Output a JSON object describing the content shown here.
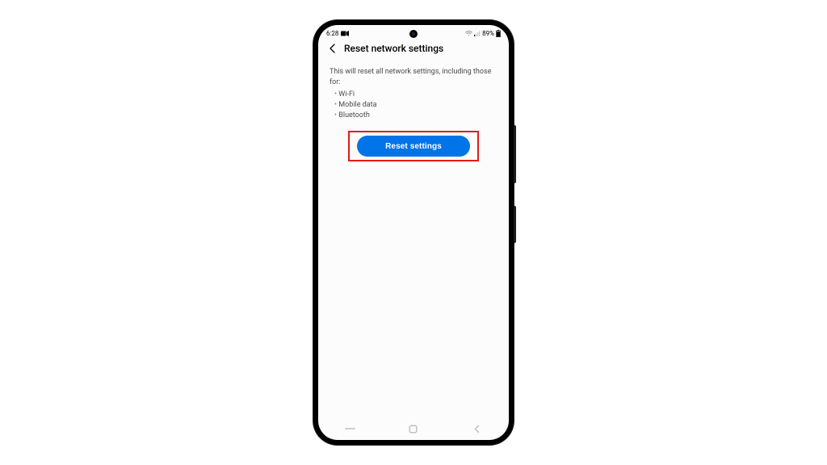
{
  "status": {
    "time": "6:28",
    "battery_pct": "89%"
  },
  "header": {
    "title": "Reset network settings"
  },
  "content": {
    "intro": "This will reset all network settings, including those for:",
    "items": [
      "Wi-Fi",
      "Mobile data",
      "Bluetooth"
    ]
  },
  "button": {
    "label": "Reset settings"
  },
  "colors": {
    "accent": "#0074e8",
    "highlight_border": "#e11b1b"
  }
}
